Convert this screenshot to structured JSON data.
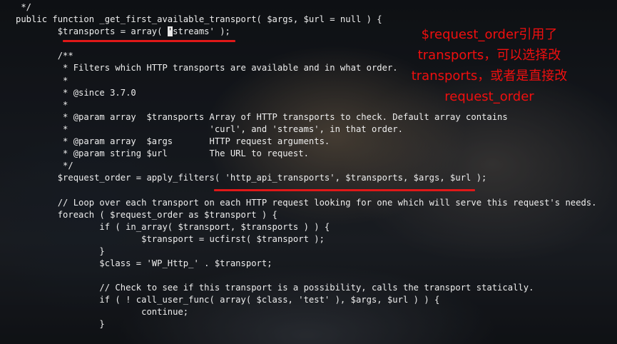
{
  "code_lines": [
    "    */",
    "   public function _get_first_available_transport( $args, $url = null ) {",
    "           $transports = array( ",
    "",
    "           /**",
    "            * Filters which HTTP transports are available and in what order.",
    "            *",
    "            * @since 3.7.0",
    "            *",
    "            * @param array  $transports Array of HTTP transports to check. Default array contains",
    "            *                           'curl', and 'streams', in that order.",
    "            * @param array  $args       HTTP request arguments.",
    "            * @param string $url        The URL to request.",
    "            */",
    "           $request_order = apply_filters( 'http_api_transports', $transports, $args, $url );",
    "",
    "           // Loop over each transport on each HTTP request looking for one which will serve this request's needs.",
    "           foreach ( $request_order as $transport ) {",
    "                   if ( in_array( $transport, $transports ) ) {",
    "                           $transport = ucfirst( $transport );",
    "                   }",
    "                   $class = 'WP_Http_' . $transport;",
    "",
    "                   // Check to see if this transport is a possibility, calls the transport statically.",
    "                   if ( ! call_user_func( array( $class, 'test' ), $args, $url ) ) {",
    "                           continue;",
    "                   }"
  ],
  "cursor_char": "'",
  "line2_rest": "streams' );",
  "annotation": [
    "$request_order引用了",
    "transports，可以选择改",
    "transports，或者是直接改",
    "request_order"
  ],
  "colors": {
    "annotation": "#f00f0f",
    "underline": "#e01818",
    "code_text": "#eeeeee"
  }
}
